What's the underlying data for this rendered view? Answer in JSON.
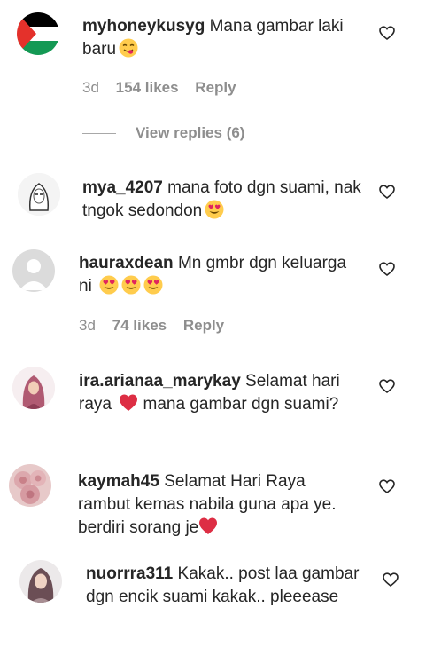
{
  "comments": [
    {
      "username": "myhoneykusyg",
      "text": "Mana gambar laki baru",
      "emoji": "yum-face-emoji",
      "time": "3d",
      "likes": "154 likes",
      "reply": "Reply",
      "view_replies": "View replies (6)"
    },
    {
      "username": "mya_4207",
      "text": "mana foto dgn suami, nak tngok sedondon",
      "emoji": "heart-eyes-emoji"
    },
    {
      "username": "hauraxdean",
      "text": "Mn gmbr dgn keluarga ni",
      "emoji": "heart-eyes-emoji x3",
      "time": "3d",
      "likes": "74 likes",
      "reply": "Reply"
    },
    {
      "username": "ira.arianaa_marykay",
      "text_a": "Selamat hari raya",
      "text_b": "mana gambar dgn suami?",
      "emoji": "red-heart-emoji"
    },
    {
      "username": "kaymah45",
      "text": "Selamat Hari Raya rambut kemas nabila guna apa ye. berdiri sorang je",
      "emoji": "red-heart-emoji"
    },
    {
      "username": "nuorrra311",
      "text": "Kakak.. post laa gambar dgn encik suami kakak.. pleeease"
    }
  ],
  "colors": {
    "text": "#262626",
    "meta": "#8e8e8e",
    "heart": "#ed1c24",
    "emoji_yellow": "#ffcc4d"
  },
  "icons": {
    "like": "heart-outline-icon"
  }
}
